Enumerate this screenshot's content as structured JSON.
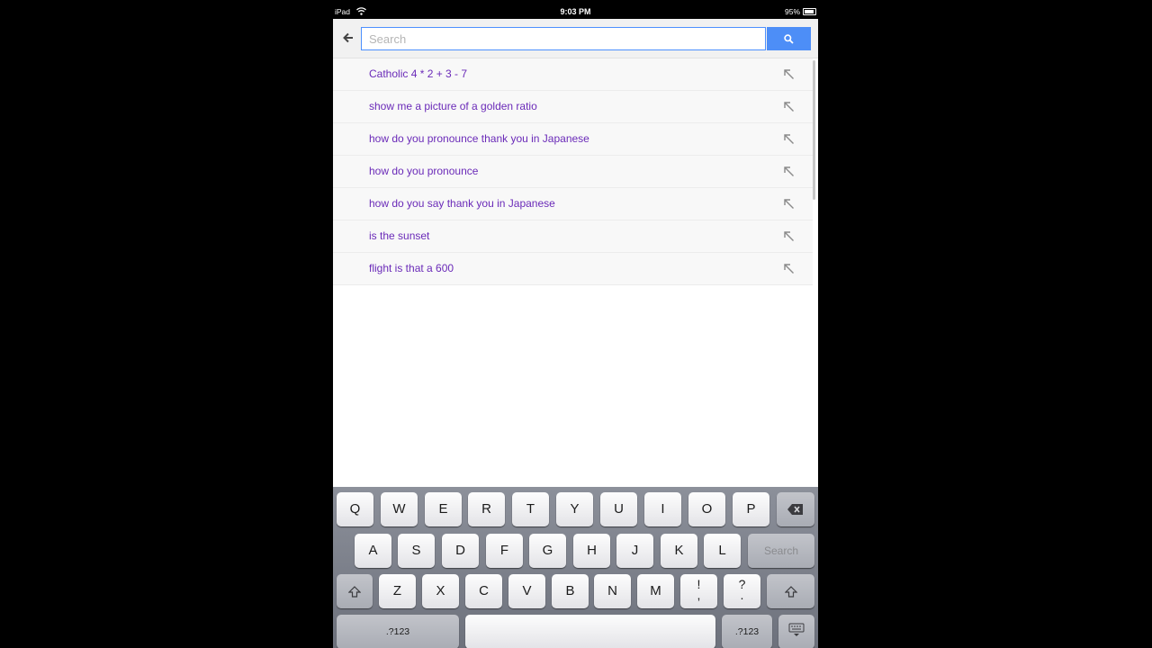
{
  "status_bar": {
    "carrier": "iPad",
    "time": "9:03 PM",
    "battery": "95%"
  },
  "search": {
    "placeholder": "Search",
    "value": ""
  },
  "icons": {
    "back": "arrow-left-icon",
    "search": "magnifier-icon",
    "fill": "arrow-up-left-icon",
    "shift": "shift-arrow-icon",
    "delete": "backspace-icon",
    "hide_keyboard": "keyboard-dismiss-icon"
  },
  "suggestions": [
    "Catholic 4 * 2 + 3 - 7",
    "show me a picture of a golden ratio",
    "how do you pronounce thank you in Japanese",
    "how do you pronounce",
    "how do you say thank you in Japanese",
    "is the sunset",
    "flight is that a 600"
  ],
  "keyboard": {
    "row1": [
      "Q",
      "W",
      "E",
      "R",
      "T",
      "Y",
      "U",
      "I",
      "O",
      "P"
    ],
    "row2": [
      "A",
      "S",
      "D",
      "F",
      "G",
      "H",
      "J",
      "K",
      "L"
    ],
    "row3": [
      "Z",
      "X",
      "C",
      "V",
      "B",
      "N",
      "M"
    ],
    "exclaim": "!",
    "question": "?",
    "comma": ",",
    "period": ".",
    "search_key": "Search",
    "numbers_left": ".?123",
    "numbers_right": ".?123"
  },
  "colors": {
    "accent": "#4d8ef7",
    "suggestion_text": "#6a2ab8"
  }
}
